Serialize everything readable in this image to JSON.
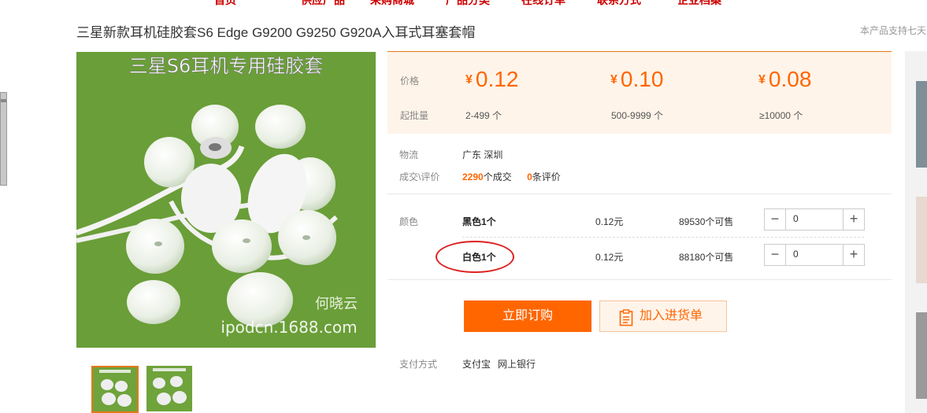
{
  "nav": {
    "items": [
      "首页",
      "供应产品",
      "采购商城",
      "产品分类",
      "在线订单",
      "联系方式",
      "企业档案"
    ]
  },
  "product": {
    "title": "三星新款耳机硅胶套S6 Edge G9200 G9250 G920A入耳式耳塞套帽",
    "support_note": "本产品支持七天",
    "image_text": "三星S6耳机专用硅胶套",
    "watermark_name": "何晓云",
    "watermark_url": "ipodcn.1688.com"
  },
  "pricing": {
    "price_label": "价格",
    "moq_label": "起批量",
    "tiers": [
      {
        "currency": "¥",
        "price": "0.12",
        "range": "2-499 个"
      },
      {
        "currency": "¥",
        "price": "0.10",
        "range": "500-9999 个"
      },
      {
        "currency": "¥",
        "price": "0.08",
        "range": "≥10000 个"
      }
    ]
  },
  "logistics": {
    "label": "物流",
    "location": "广东 深圳"
  },
  "stats": {
    "label": "成交\\评价",
    "deals": "2290",
    "deals_unit": "个成交",
    "reviews": "0",
    "reviews_unit": "条评价"
  },
  "variants": {
    "label": "颜色",
    "rows": [
      {
        "name": "黑色1个",
        "price": "0.12元",
        "stock": "89530个可售",
        "qty": "0"
      },
      {
        "name": "白色1个",
        "price": "0.12元",
        "stock": "88180个可售",
        "qty": "0"
      }
    ],
    "minus": "−",
    "plus": "+"
  },
  "actions": {
    "buy_now": "立即订购",
    "add_to_list": "加入进货单"
  },
  "payment": {
    "label": "支付方式",
    "methods": [
      "支付宝",
      "网上银行"
    ]
  },
  "colors": {
    "accent": "#ff6600",
    "price_bg": "#fff4e9",
    "highlight_circle": "#dd2222",
    "image_green": "#6fa33b"
  }
}
